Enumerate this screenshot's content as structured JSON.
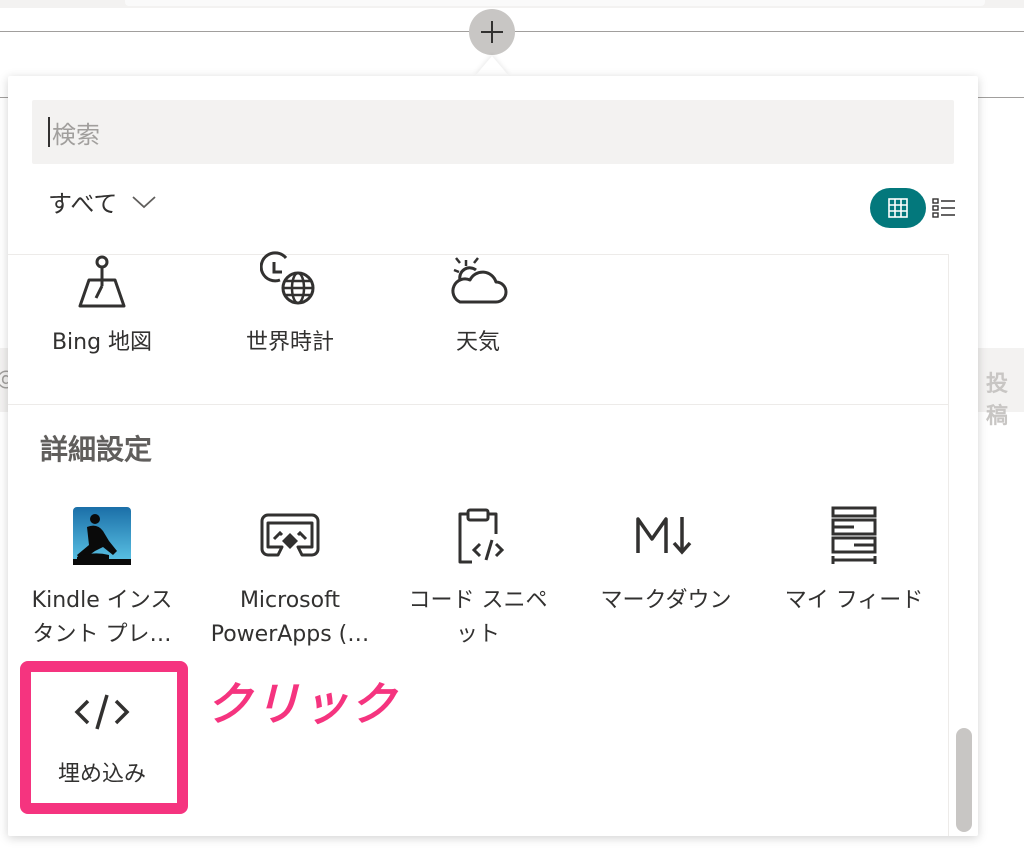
{
  "search": {
    "placeholder": "検索"
  },
  "filter": {
    "label": "すべて"
  },
  "tiles_top": [
    {
      "label": "Bing 地図",
      "icon": "map-pin-icon"
    },
    {
      "label": "世界時計",
      "icon": "world-clock-icon"
    },
    {
      "label": "天気",
      "icon": "weather-icon"
    }
  ],
  "advanced": {
    "title": "詳細設定",
    "tiles": [
      {
        "label_line1": "Kindle インス",
        "label_line2": "タント プレ…",
        "icon": "kindle-icon"
      },
      {
        "label_line1": "Microsoft",
        "label_line2": "PowerApps (…",
        "icon": "powerapps-icon"
      },
      {
        "label_line1": "コード スニペ",
        "label_line2": "ット",
        "icon": "code-snippet-icon"
      },
      {
        "label_line1": "マークダウン",
        "label_line2": "",
        "icon": "markdown-icon"
      },
      {
        "label_line1": "マイ フィード",
        "label_line2": "",
        "icon": "my-feed-icon"
      }
    ],
    "embed": {
      "label": "埋め込み",
      "icon": "embed-icon"
    }
  },
  "annotation": {
    "text": "クリック",
    "color": "#f5347f"
  },
  "background": {
    "left_text": "@",
    "right_text": "投稿"
  },
  "colors": {
    "accent": "#03787c",
    "highlight": "#f5347f"
  }
}
